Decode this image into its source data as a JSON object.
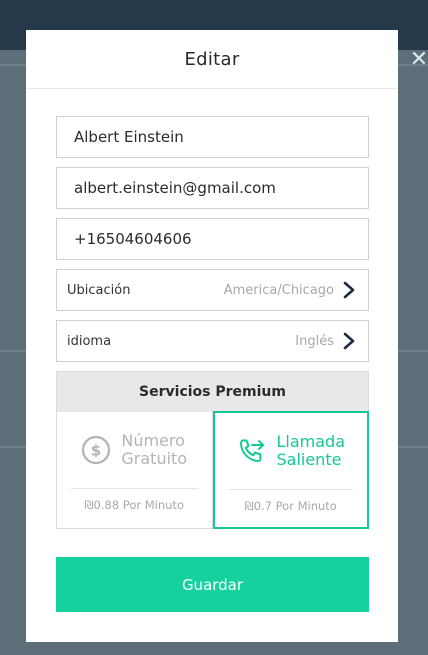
{
  "modal": {
    "title": "Editar",
    "close_glyph": "✕"
  },
  "form": {
    "name": "Albert Einstein",
    "email": "albert.einstein@gmail.com",
    "phone": "+16504604606",
    "location": {
      "label": "Ubicación",
      "value": "America/Chicago",
      "icon": "chevron-right-icon"
    },
    "language": {
      "label": "idioma",
      "value": "Inglés",
      "icon": "chevron-right-icon"
    }
  },
  "premium": {
    "title": "Servicios Premium",
    "options": [
      {
        "line1": "Número",
        "line2": "Gratuito",
        "price": "₪0.88 Por Minuto",
        "icon": "dollar-circle-icon",
        "selected": false
      },
      {
        "line1": "Llamada",
        "line2": "Saliente",
        "price": "₪0.7 Por Minuto",
        "icon": "phone-outgoing-icon",
        "selected": true
      }
    ]
  },
  "save_label": "Guardar",
  "colors": {
    "accent": "#14c997",
    "button": "#14d19e",
    "backdrop": "#5d6e78",
    "topbar": "#25394a"
  }
}
